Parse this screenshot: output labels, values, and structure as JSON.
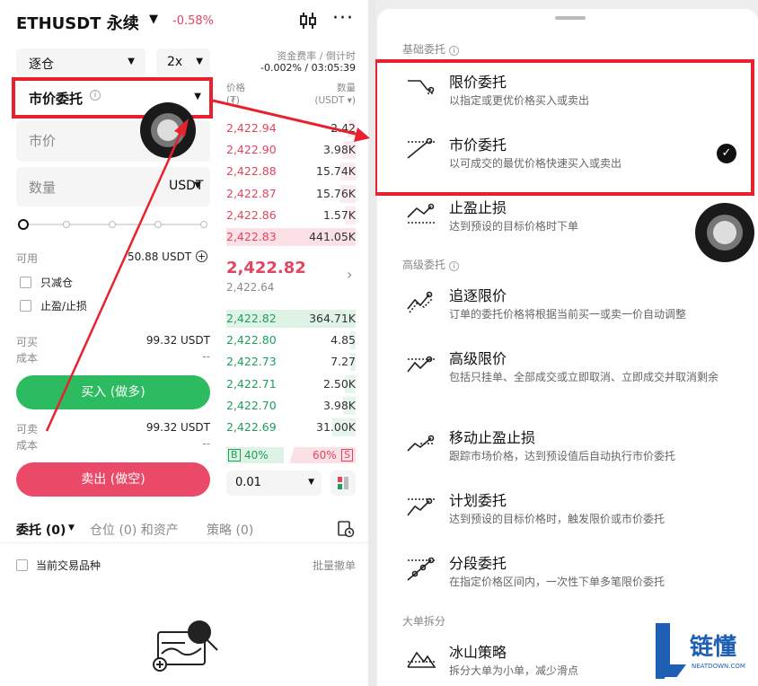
{
  "left": {
    "symbol": "ETHUSDT 永续",
    "change": "-0.58%",
    "margin_mode": "逐仓",
    "leverage": "2x",
    "funding_label": "资金费率 / 倒计时",
    "funding_value": "-0.002% / 03:05:39",
    "order_type": "市价委托",
    "price_placeholder": "市价",
    "qty_placeholder": "数量",
    "qty_unit": "USDT",
    "slider_level": 0,
    "available_label": "可用",
    "available_value": "50.88 USDT",
    "reduce_only": "只减仓",
    "tp_sl": "止盈/止损",
    "can_buy_label": "可买",
    "can_buy_value": "99.32 USDT",
    "cost_label": "成本",
    "cost_value": "--",
    "buy_button": "买入 (做多)",
    "can_sell_label": "可卖",
    "can_sell_value": "99.32 USDT",
    "cost2_label": "成本",
    "cost2_value": "--",
    "sell_button": "卖出 (做空)",
    "orderbook": {
      "price_header": "价格",
      "price_unit": "(₮)",
      "qty_header": "数量",
      "qty_unit": "(USDT ▾)",
      "asks": [
        {
          "price": "2,422.94",
          "qty": "2.42"
        },
        {
          "price": "2,422.90",
          "qty": "3.98K"
        },
        {
          "price": "2,422.88",
          "qty": "15.74K"
        },
        {
          "price": "2,422.87",
          "qty": "15.76K"
        },
        {
          "price": "2,422.86",
          "qty": "1.57K"
        },
        {
          "price": "2,422.83",
          "qty": "441.05K"
        }
      ],
      "last_price": "2,422.82",
      "mark_price": "2,422.64",
      "bids": [
        {
          "price": "2,422.82",
          "qty": "364.71K"
        },
        {
          "price": "2,422.80",
          "qty": "4.85"
        },
        {
          "price": "2,422.73",
          "qty": "7.27"
        },
        {
          "price": "2,422.71",
          "qty": "2.50K"
        },
        {
          "price": "2,422.70",
          "qty": "3.98K"
        },
        {
          "price": "2,422.69",
          "qty": "31.00K"
        }
      ],
      "buy_ratio_label": "B",
      "buy_ratio": "40%",
      "sell_ratio": "60%",
      "sell_ratio_label": "S",
      "precision": "0.01"
    },
    "tabs": {
      "orders": "委托 (0)",
      "positions": "仓位 (0) 和资产",
      "strategies": "策略 (0)"
    },
    "current_symbol_only": "当前交易品种",
    "batch_cancel": "批量撤单"
  },
  "right": {
    "section_basic": "基础委托",
    "section_advanced": "高级委托",
    "section_large": "大单拆分",
    "items": [
      {
        "title": "限价委托",
        "desc": "以指定或更优价格买入或卖出",
        "icon": "limit-order-icon"
      },
      {
        "title": "市价委托",
        "desc": "以可成交的最优价格快速买入或卖出",
        "icon": "market-order-icon"
      },
      {
        "title": "止盈止损",
        "desc": "达到预设的目标价格时下单",
        "icon": "tp-sl-icon"
      },
      {
        "title": "追逐限价",
        "desc": "订单的委托价格将根据当前买一或卖一价自动调整",
        "icon": "chase-limit-icon"
      },
      {
        "title": "高级限价",
        "desc": "包括只挂单、全部成交或立即取消、立即成交并取消剩余",
        "icon": "advanced-limit-icon"
      },
      {
        "title": "移动止盈止损",
        "desc": "跟踪市场价格，达到预设值后自动执行市价委托",
        "icon": "trailing-stop-icon"
      },
      {
        "title": "计划委托",
        "desc": "达到预设的目标价格时，触发限价或市价委托",
        "icon": "trigger-order-icon"
      },
      {
        "title": "分段委托",
        "desc": "在指定价格区间内，一次性下单多笔限价委托",
        "icon": "scaled-order-icon"
      },
      {
        "title": "冰山策略",
        "desc": "拆分大单为小单，减少滑点",
        "icon": "iceberg-icon"
      }
    ],
    "watermark": {
      "brand": "链懂",
      "url": "NEATDOWN.COM"
    }
  },
  "colors": {
    "buy": "#2dbb62",
    "sell": "#ea4a68",
    "highlight": "#e8212e"
  }
}
